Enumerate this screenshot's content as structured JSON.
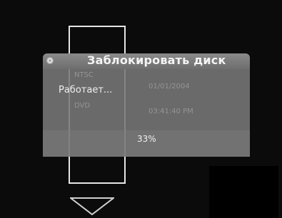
{
  "dialog": {
    "title": "Заблокировать диск",
    "status": "Работает...",
    "progress_label": "33%",
    "progress": 0.33,
    "info": {
      "format": "NTSC",
      "date": "01/01/2004",
      "media": "DVD",
      "time": "03:41:40 PM"
    }
  },
  "icons": {
    "dialog_icon": "disc-icon",
    "bottom_arrow": "down-arrow-icon"
  },
  "colors": {
    "background": "#0b0b0b",
    "dialog": "#787878",
    "text": "#f4f4f4"
  }
}
